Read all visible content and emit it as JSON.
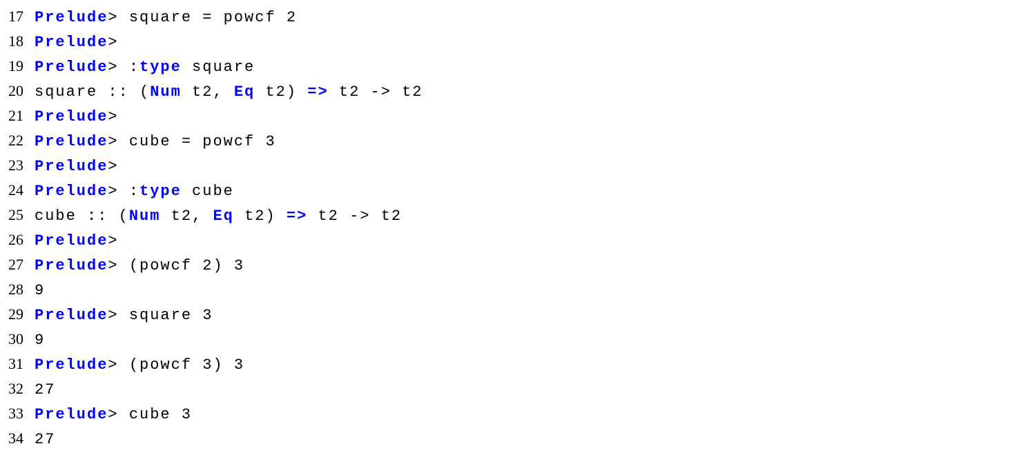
{
  "linenos": {
    "l17": "17",
    "l18": "18",
    "l19": "19",
    "l20": "20",
    "l21": "21",
    "l22": "22",
    "l23": "23",
    "l24": "24",
    "l25": "25",
    "l26": "26",
    "l27": "27",
    "l28": "28",
    "l29": "29",
    "l30": "30",
    "l31": "31",
    "l32": "32",
    "l33": "33",
    "l34": "34"
  },
  "tokens": {
    "prelude": "Prelude",
    "gt_sp": "> ",
    "gt": ">",
    "type_kw": "type",
    "num_kw": "Num",
    "eq_kw": "Eq",
    "fat_arrow": "=>",
    "square_eq_powcf_2": "square = powcf 2",
    "colon": ":",
    "sp_square": " square",
    "square_sig_pre": "square :: (",
    "sp_t2_comma_sp": " t2, ",
    "sp_t2_rparen_sp": " t2) ",
    "sp_t2_arrow_t2": " t2 -> t2",
    "cube_eq_powcf_3": "cube = powcf 3",
    "sp_cube": " cube",
    "cube_sig_pre": "cube :: (",
    "expr_powcf2_3": "(powcf 2) 3",
    "val_9": "9",
    "square_3": "square 3",
    "expr_powcf3_3": "(powcf 3) 3",
    "val_27": "27",
    "cube_3": "cube 3"
  }
}
